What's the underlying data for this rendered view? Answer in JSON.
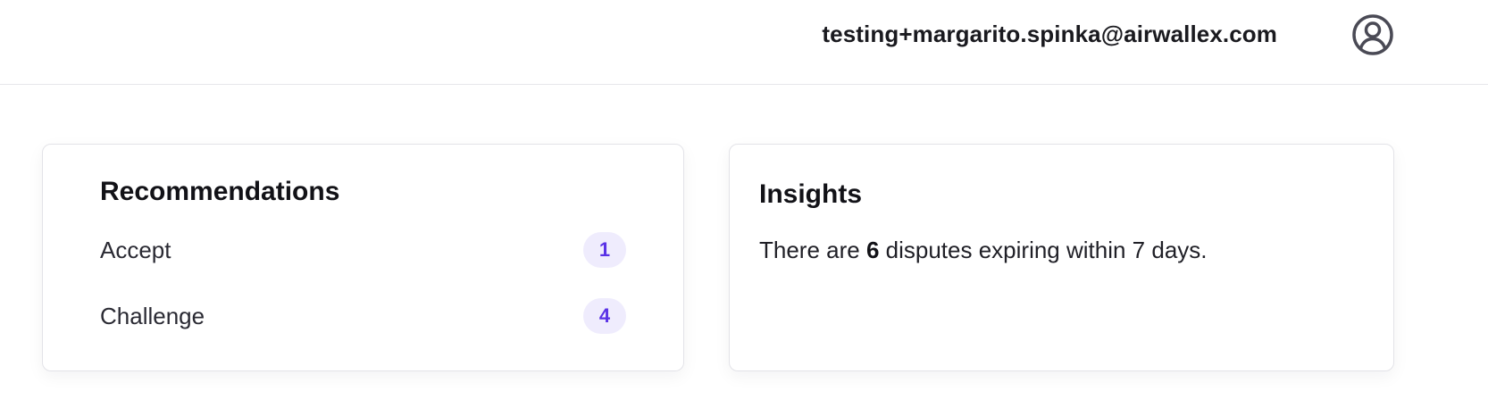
{
  "header": {
    "user_email": "testing+margarito.spinka@airwallex.com",
    "avatar_icon": "user-circle-icon"
  },
  "recommendations": {
    "title": "Recommendations",
    "items": [
      {
        "label": "Accept",
        "count": "1"
      },
      {
        "label": "Challenge",
        "count": "4"
      }
    ],
    "badge_bg": "#efecfd",
    "badge_color": "#5a32e6"
  },
  "insights": {
    "title": "Insights",
    "text_before": "There are ",
    "count": "6",
    "text_after": " disputes expiring within 7 days."
  }
}
